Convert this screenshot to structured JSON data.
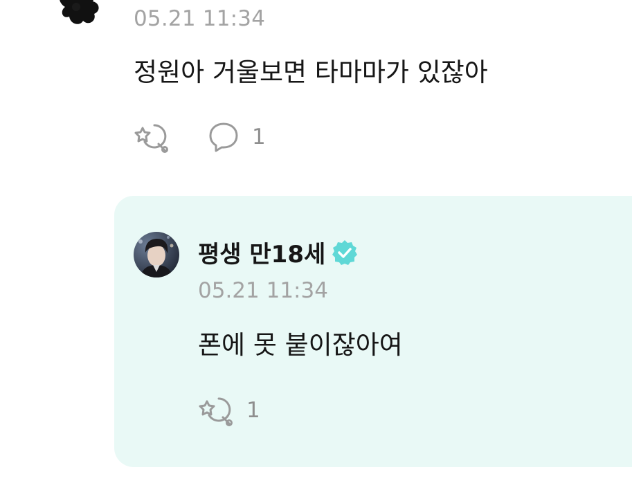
{
  "comment": {
    "time": "05.21 11:34",
    "text": "정원아 거울보면 타마마가 있잖아",
    "actions": {
      "reaction_icon": "reaction-icon",
      "reaction_count": "",
      "reply_icon": "speech-bubble-icon",
      "reply_count": "1"
    }
  },
  "reply": {
    "author": "평생 만18세",
    "verified_icon": "verified-badge-icon",
    "verified_color": "#5fd8d6",
    "time": "05.21 11:34",
    "text": "폰에 못 붙이잖아여",
    "actions": {
      "reaction_icon": "reaction-icon",
      "reaction_count": "1"
    },
    "card_color": "#e9f9f6"
  }
}
